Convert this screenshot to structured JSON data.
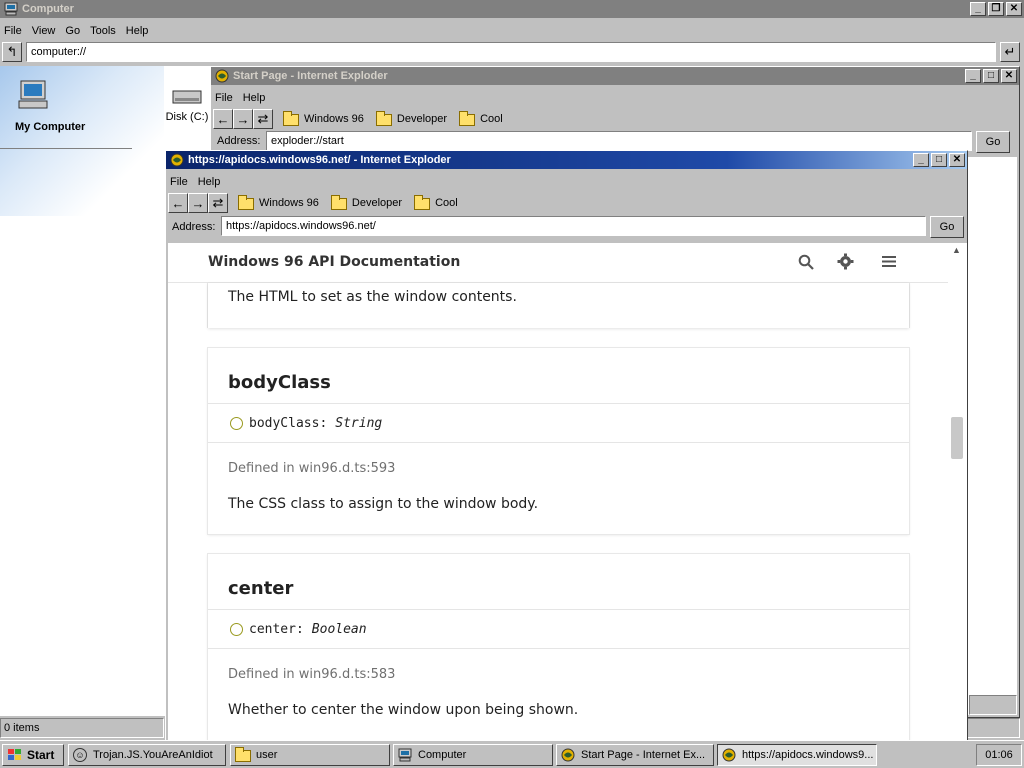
{
  "computer": {
    "title": "Computer",
    "menu": [
      "File",
      "View",
      "Go",
      "Tools",
      "Help"
    ],
    "address": "computer://",
    "my_computer_label": "My Computer",
    "disk_label": "Disk (C:)",
    "status": "0 items"
  },
  "start_page": {
    "title": "Start Page - Internet Exploder",
    "menu": [
      "File",
      "Help"
    ],
    "bookmarks": [
      "Windows 96",
      "Developer",
      "Cool"
    ],
    "address_label": "Address:",
    "address": "exploder://start",
    "go": "Go"
  },
  "api_window": {
    "title": "https://apidocs.windows96.net/ - Internet Exploder",
    "menu": [
      "File",
      "Help"
    ],
    "bookmarks": [
      "Windows 96",
      "Developer",
      "Cool"
    ],
    "address_label": "Address:",
    "address": "https://apidocs.windows96.net/",
    "go": "Go"
  },
  "docs": {
    "site_title": "Windows 96 API Documentation",
    "partial_card_text": "The HTML to set as the window contents.",
    "cards": [
      {
        "name": "bodyClass",
        "sig_name": "bodyClass:",
        "sig_type": "String",
        "defined": "Defined in win96.d.ts:593",
        "description": "The CSS class to assign to the window body."
      },
      {
        "name": "center",
        "sig_name": "center:",
        "sig_type": "Boolean",
        "defined": "Defined in win96.d.ts:583",
        "description": "Whether to center the window upon being shown."
      }
    ]
  },
  "taskbar": {
    "start": "Start",
    "tasks": [
      "Trojan.JS.YouAreAnIdiot",
      "user",
      "Computer",
      "Start Page - Internet Ex...",
      "https://apidocs.windows9..."
    ],
    "clock": "01:06"
  },
  "colors": {
    "active_title": "#0a246a",
    "inactive_title": "#808080",
    "face": "#c0c0c0"
  }
}
